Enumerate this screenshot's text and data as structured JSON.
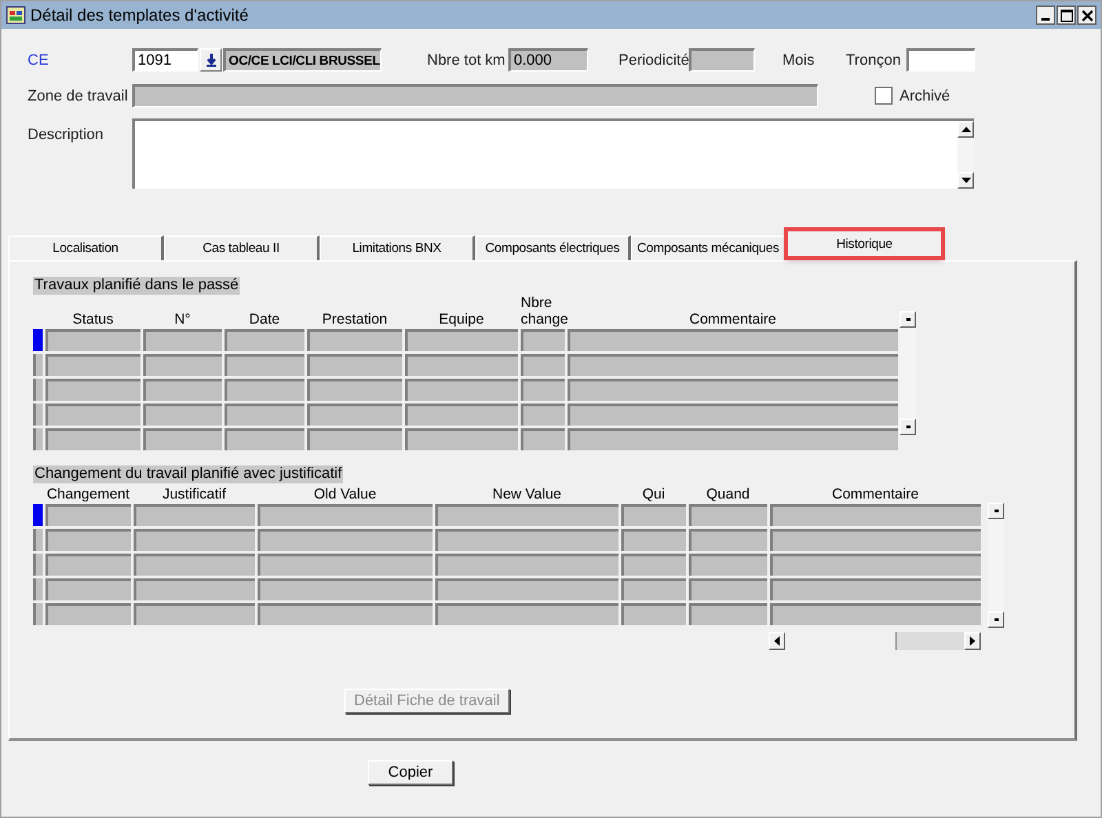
{
  "window": {
    "title": "Détail des templates d'activité"
  },
  "form": {
    "ce": {
      "label": "CE",
      "value": "1091",
      "description": "OC/CE LCI/CLI BRUSSEL"
    },
    "nbre_tot_km": {
      "label": "Nbre tot km",
      "value": "0.000"
    },
    "periodicite": {
      "label": "Periodicité",
      "unit": "Mois"
    },
    "troncon": {
      "label": "Tronçon"
    },
    "zone_de_travail": {
      "label": "Zone de travail"
    },
    "archive": {
      "label": "Archivé",
      "checked": false
    },
    "description": {
      "label": "Description"
    }
  },
  "tabs": [
    {
      "label": "Localisation",
      "selected": false,
      "highlighted": false
    },
    {
      "label": "Cas tableau II",
      "selected": false,
      "highlighted": false
    },
    {
      "label": "Limitations BNX",
      "selected": false,
      "highlighted": false
    },
    {
      "label": "Composants électriques",
      "selected": false,
      "highlighted": false
    },
    {
      "label": "Composants mécaniques",
      "selected": false,
      "highlighted": false
    },
    {
      "label": "Historique",
      "selected": true,
      "highlighted": true
    }
  ],
  "tables": [
    {
      "title": "Travaux planifié dans le passé",
      "columns": [
        "Status",
        "N°",
        "Date",
        "Prestation",
        "Equipe",
        "Nbre change",
        "Commentaire"
      ],
      "rows": [
        {
          "current": true
        },
        {
          "current": false
        },
        {
          "current": false
        },
        {
          "current": false
        },
        {
          "current": false
        }
      ]
    },
    {
      "title": "Changement du travail planifié avec justificatif",
      "columns": [
        "Changement",
        "Justificatif",
        "Old Value",
        "New Value",
        "Qui",
        "Quand",
        "Commentaire"
      ],
      "rows": [
        {
          "current": true
        },
        {
          "current": false
        },
        {
          "current": false
        },
        {
          "current": false
        },
        {
          "current": false
        }
      ]
    }
  ],
  "detail_button": {
    "label": "Détail Fiche de travail",
    "disabled": true
  },
  "copy_button": {
    "label": "Copier",
    "disabled": false
  }
}
